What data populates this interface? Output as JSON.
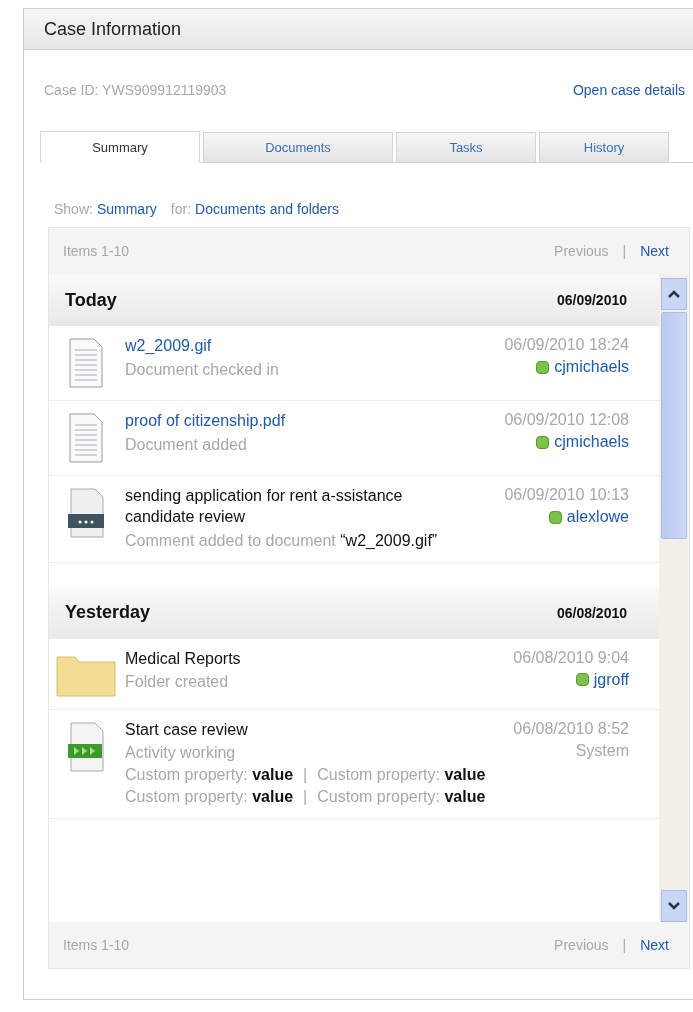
{
  "panel": {
    "title": "Case Information"
  },
  "case": {
    "id_label": "Case ID: YWS909912119903",
    "open_link": "Open case details"
  },
  "tabs": [
    {
      "label": "Summary",
      "selected": true
    },
    {
      "label": "Documents",
      "selected": false
    },
    {
      "label": "Tasks",
      "selected": false
    },
    {
      "label": "History",
      "selected": false
    }
  ],
  "filter": {
    "show_label": "Show:",
    "show_value": "Summary",
    "for_label": "for:",
    "for_value": "Documents and folders"
  },
  "pager_top": {
    "range": "Items 1-10",
    "previous": "Previous",
    "separator": "|",
    "next": "Next"
  },
  "groups": [
    {
      "label": "Today",
      "date": "06/09/2010",
      "items": [
        {
          "kind": "document",
          "title": "w2_2009.gif",
          "link": true,
          "action": "Document checked in",
          "timestamp": "06/09/2010 18:24",
          "user": "cjmichaels",
          "presence": true
        },
        {
          "kind": "document",
          "title": "proof of citizenship.pdf",
          "link": true,
          "action": "Document added",
          "timestamp": "06/09/2010 12:08",
          "user": "cjmichaels",
          "presence": true
        },
        {
          "kind": "comment",
          "title": "sending application for rent a-ssistance candidate review",
          "link": false,
          "action": "Comment added to document",
          "target": "“w2_2009.gif”",
          "timestamp": "06/09/2010 10:13",
          "user": "alexlowe",
          "presence": true
        }
      ]
    },
    {
      "label": "Yesterday",
      "date": "06/08/2010",
      "items": [
        {
          "kind": "folder",
          "title": "Medical Reports",
          "link": false,
          "action": "Folder created",
          "timestamp": "06/08/2010 9:04",
          "user": "jgroff",
          "presence": true
        },
        {
          "kind": "activity",
          "title": "Start case review",
          "link": false,
          "action": "Activity working",
          "timestamp": "06/08/2010 8:52",
          "user": "System",
          "presence": false,
          "properties": [
            {
              "separator": "|",
              "cells": [
                {
                  "label": "Custom property:",
                  "value": "value"
                },
                {
                  "label": "Custom property:",
                  "value": "value"
                }
              ]
            },
            {
              "separator": "|",
              "cells": [
                {
                  "label": "Custom property:",
                  "value": "value"
                },
                {
                  "label": "Custom property:",
                  "value": "value"
                }
              ]
            }
          ]
        }
      ]
    }
  ],
  "pager_bottom": {
    "range": "Items 1-10",
    "previous": "Previous",
    "separator": "|",
    "next": "Next"
  }
}
